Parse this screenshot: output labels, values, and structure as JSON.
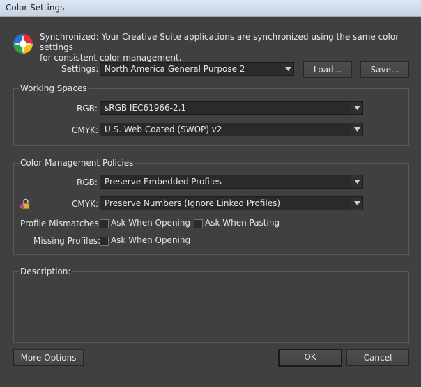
{
  "window": {
    "title": "Color Settings"
  },
  "sync": {
    "icon": "color-wheel-icon",
    "message_line1": "Synchronized: Your Creative Suite applications are synchronized using the same color settings",
    "message_line2": "for consistent color management."
  },
  "settings": {
    "label": "Settings:",
    "value": "North America General Purpose 2",
    "load_label": "Load...",
    "save_label": "Save..."
  },
  "working_spaces": {
    "title": "Working Spaces",
    "rgb_label": "RGB:",
    "rgb_value": "sRGB IEC61966-2.1",
    "cmyk_label": "CMYK:",
    "cmyk_value": "U.S. Web Coated (SWOP) v2"
  },
  "policies": {
    "title": "Color Management Policies",
    "rgb_label": "RGB:",
    "rgb_value": "Preserve Embedded Profiles",
    "cmyk_label": "CMYK:",
    "cmyk_value": "Preserve Numbers (Ignore Linked Profiles)",
    "mismatch_label": "Profile Mismatches:",
    "ask_opening_label": "Ask When Opening",
    "ask_pasting_label": "Ask When Pasting",
    "missing_label": "Missing Profiles:",
    "missing_ask_opening_label": "Ask When Opening",
    "mismatch_ask_opening_checked": false,
    "mismatch_ask_pasting_checked": false,
    "missing_ask_opening_checked": false
  },
  "description": {
    "title": "Description:"
  },
  "footer": {
    "more_options_label": "More Options",
    "ok_label": "OK",
    "cancel_label": "Cancel"
  }
}
